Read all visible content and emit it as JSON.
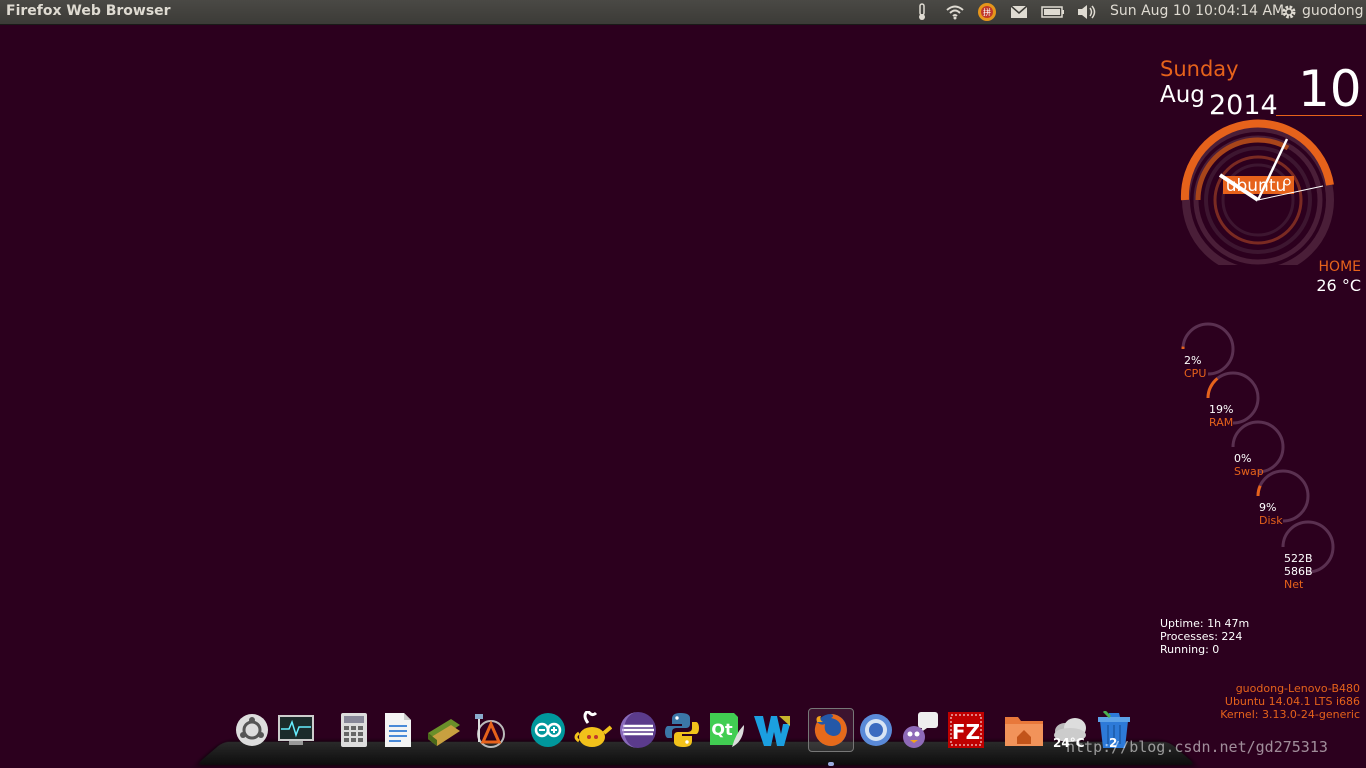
{
  "panel": {
    "app_title": "Firefox Web Browser",
    "clock": "Sun Aug 10 10:04:14 AM",
    "user": "guodong",
    "indicators": [
      "thermometer-icon",
      "wifi-icon",
      "input-method-icon",
      "mail-icon",
      "battery-icon",
      "volume-icon",
      "gear-icon"
    ]
  },
  "calendar": {
    "day_name": "Sunday",
    "month": "Aug",
    "year": "2014",
    "day": "10",
    "logo_text": "ubuntu"
  },
  "weather": {
    "location": "HOME",
    "temp": "26 °C"
  },
  "stats": {
    "cpu": {
      "value": "2%",
      "label": "CPU",
      "fraction": 0.02
    },
    "ram": {
      "value": "19%",
      "label": "RAM",
      "fraction": 0.19
    },
    "swap": {
      "value": "0%",
      "label": "Swap",
      "fraction": 0.0
    },
    "disk": {
      "value": "9%",
      "label": "Disk",
      "fraction": 0.09
    },
    "net": {
      "down": "522B",
      "up": "586B",
      "label": "Net"
    }
  },
  "system": {
    "uptime": "Uptime: 1h 47m",
    "processes": "Processes: 224",
    "running": "Running: 0"
  },
  "host": {
    "name": "guodong-Lenovo-B480",
    "os": "Ubuntu 14.04.1 LTS  i686",
    "kernel": "Kernel: 3.13.0-24-generic"
  },
  "dock": {
    "items": [
      "ubuntu-logo-icon",
      "system-monitor-icon",
      "calculator-icon",
      "libreoffice-writer-icon",
      "books-icon",
      "inkscape-icon",
      "arduino-icon",
      "genie-teapot-icon",
      "eclipse-icon",
      "python-icon",
      "qt-creator-icon",
      "webstorm-icon",
      "firefox-icon",
      "chromium-icon",
      "pidgin-icon",
      "filezilla-icon",
      "home-folder-icon",
      "weather-icon",
      "trash-icon"
    ],
    "weather_temp": "24°C",
    "trash_count": "2",
    "colors": {
      "accent": "#e6621b",
      "background": "#2c001e"
    }
  },
  "watermark": "http://blog.csdn.net/gd275313"
}
